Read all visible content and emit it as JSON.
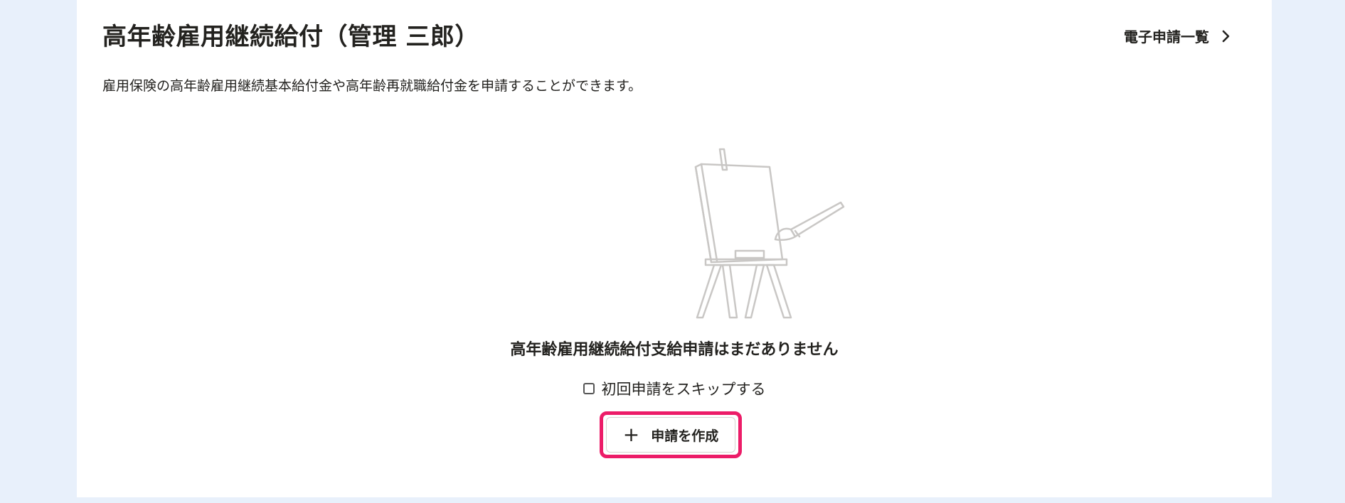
{
  "header": {
    "title": "高年齢雇用継続給付（管理 三郎）",
    "list_link_label": "電子申請一覧",
    "list_link_icon": "chevron-right-icon"
  },
  "description": "雇用保険の高年齢雇用継続基本給付金や高年齢再就職給付金を申請することができます。",
  "empty_state": {
    "illustration": "easel-with-paintbrush-illustration",
    "message": "高年齢雇用継続給付支給申請はまだありません",
    "skip_checkbox_label": "初回申請をスキップする",
    "skip_checked": false,
    "create_button_label": "申請を作成",
    "create_button_icon": "plus-icon",
    "highlight_color": "#ec1c68"
  }
}
